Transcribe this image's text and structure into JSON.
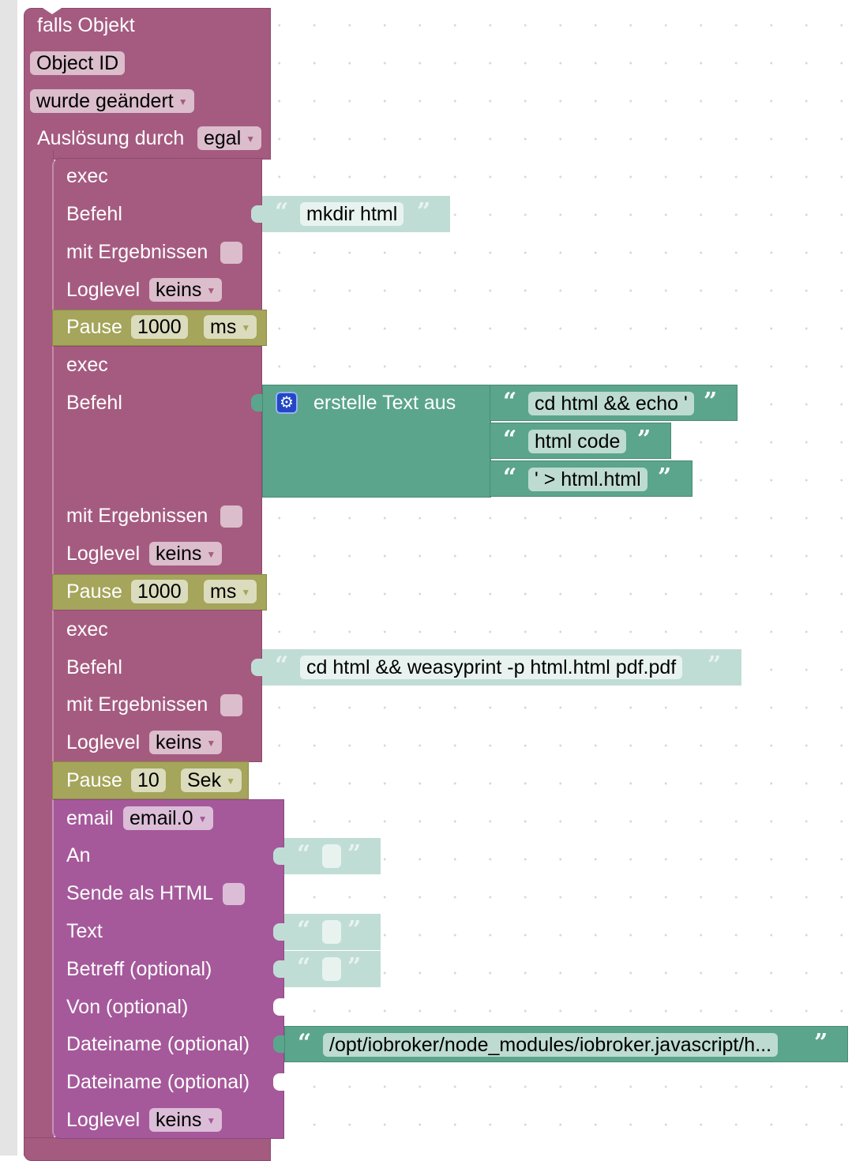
{
  "trigger_block": {
    "title": "falls Objekt",
    "object_id": "Object ID",
    "condition": "wurde geändert",
    "trigger_label": "Auslösung durch",
    "trigger_value": "egal"
  },
  "exec_blocks": [
    {
      "title": "exec",
      "command_label": "Befehl",
      "command_value": "mkdir html",
      "results_label": "mit Ergebnissen",
      "results_checked": false,
      "loglevel_label": "Loglevel",
      "loglevel_value": "keins"
    },
    {
      "title": "exec",
      "command_label": "Befehl",
      "join_block": {
        "title": "erstelle Text aus",
        "icon": "gear-icon",
        "items": [
          "cd html && echo '",
          "html code",
          "' > html.html"
        ]
      },
      "results_label": "mit Ergebnissen",
      "results_checked": false,
      "loglevel_label": "Loglevel",
      "loglevel_value": "keins"
    },
    {
      "title": "exec",
      "command_label": "Befehl",
      "command_value": "cd html && weasyprint -p html.html pdf.pdf",
      "results_label": "mit Ergebnissen",
      "results_checked": false,
      "loglevel_label": "Loglevel",
      "loglevel_value": "keins"
    }
  ],
  "pause_blocks": [
    {
      "label": "Pause",
      "value": "1000",
      "unit": "ms"
    },
    {
      "label": "Pause",
      "value": "1000",
      "unit": "ms"
    },
    {
      "label": "Pause",
      "value": "10",
      "unit": "Sek"
    }
  ],
  "email_block": {
    "title": "email",
    "instance": "email.0",
    "to_label": "An",
    "to_value": "",
    "html_label": "Sende als HTML",
    "html_checked": false,
    "text_label": "Text",
    "text_value": "",
    "subject_label": "Betreff (optional)",
    "subject_value": "",
    "from_label": "Von (optional)",
    "file1_label": "Dateiname (optional)",
    "file1_value": "/opt/iobroker/node_modules/iobroker.javascript/h...",
    "file2_label": "Dateiname (optional)",
    "loglevel_label": "Loglevel",
    "loglevel_value": "keins"
  },
  "colors": {
    "trigger": "#a55b80",
    "pause": "#a5a55b",
    "email": "#a5599a",
    "text": "#5ba58c",
    "text_shadow": "#c0ddd5",
    "gear": "#2248c7"
  }
}
